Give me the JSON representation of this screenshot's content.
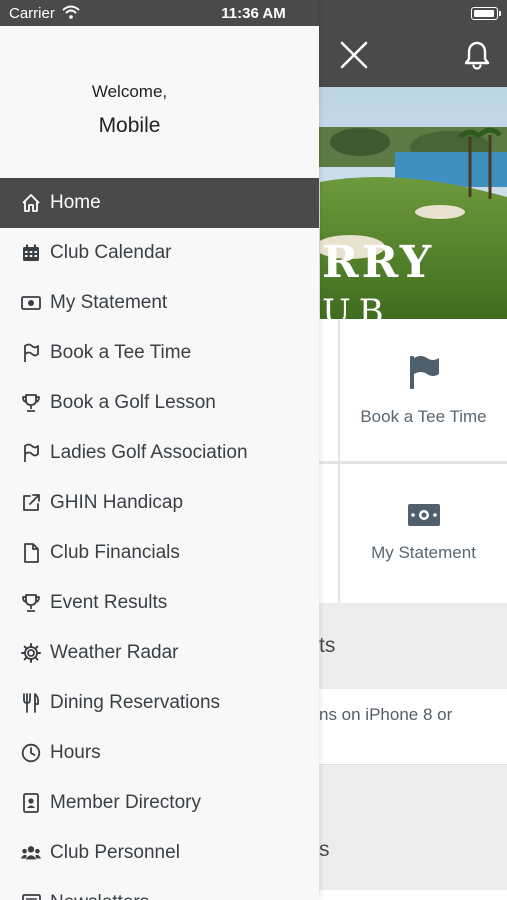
{
  "status_bar": {
    "carrier": "Carrier",
    "time": "11:36 AM"
  },
  "drawer": {
    "welcome": "Welcome,",
    "user_name": "Mobile",
    "items": [
      {
        "label": "Home",
        "icon": "home-icon",
        "active": true
      },
      {
        "label": "Club Calendar",
        "icon": "calendar-icon"
      },
      {
        "label": "My Statement",
        "icon": "money-icon"
      },
      {
        "label": "Book a Tee Time",
        "icon": "flag-icon"
      },
      {
        "label": "Book a Golf Lesson",
        "icon": "trophy-icon"
      },
      {
        "label": "Ladies Golf Association",
        "icon": "flag-icon"
      },
      {
        "label": "GHIN Handicap",
        "icon": "external-link-icon"
      },
      {
        "label": "Club Financials",
        "icon": "document-icon"
      },
      {
        "label": "Event Results",
        "icon": "trophy-icon"
      },
      {
        "label": "Weather Radar",
        "icon": "gear-icon"
      },
      {
        "label": "Dining Reservations",
        "icon": "utensils-icon"
      },
      {
        "label": "Hours",
        "icon": "clock-icon"
      },
      {
        "label": "Member Directory",
        "icon": "contact-card-icon"
      },
      {
        "label": "Club Personnel",
        "icon": "users-icon"
      },
      {
        "label": "Newsletters",
        "icon": "newspaper-icon"
      }
    ]
  },
  "header": {
    "close_icon": "close-icon",
    "bell_icon": "bell-icon"
  },
  "hero": {
    "line1": "RRY",
    "line2": "UB"
  },
  "tiles": {
    "tee_time": {
      "label": "Book a Tee Time",
      "icon": "flag-icon"
    },
    "statement": {
      "label": "My Statement",
      "icon": "money-icon"
    }
  },
  "sections": {
    "s1_title": "ts",
    "s1_body_line1": "ns on iPhone 8 or",
    "s2_title": "s"
  },
  "colors": {
    "topbar": "#4a4a4a",
    "active_item": "#4a4a4a",
    "drawer_bg": "#f8f8f8",
    "tile_icon": "#4f5f6b"
  }
}
